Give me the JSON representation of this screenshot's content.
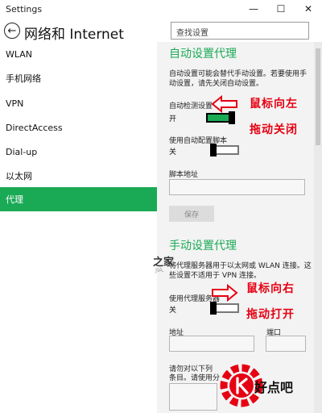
{
  "window": {
    "title": "Settings",
    "minimize": "—",
    "maximize": "☐",
    "close": "✕"
  },
  "header": {
    "back": "←",
    "title": "网络和 Internet",
    "search_placeholder": "查找设置"
  },
  "sidebar": {
    "items": [
      {
        "label": "WLAN"
      },
      {
        "label": "手机网络"
      },
      {
        "label": "VPN"
      },
      {
        "label": "DirectAccess"
      },
      {
        "label": "Dial-up"
      },
      {
        "label": "以太网"
      },
      {
        "label": "代理"
      }
    ],
    "active_index": 6
  },
  "auto_proxy": {
    "heading": "自动设置代理",
    "description": "自动设置可能会替代手动设置。若要使用手动设置，请先关闭自动设置。",
    "detect_label": "自动检测设置",
    "detect_state": "开",
    "detect_on": true,
    "script_label": "使用自动配置脚本",
    "script_state": "关",
    "script_on": false,
    "address_label": "脚本地址",
    "address_value": "",
    "save_label": "保存"
  },
  "manual_proxy": {
    "heading": "手动设置代理",
    "description": "将代理服务器用于以太网或 WLAN 连接。这些设置不适用于 VPN 连接。",
    "use_label": "使用代理服务器",
    "use_state": "关",
    "use_on": false,
    "address_label": "地址",
    "port_label": "端口",
    "address_value": "",
    "port_value": "",
    "exceptions_label": "请勿对以下列",
    "exceptions_label2": "条目。请使用分",
    "exceptions_value": ""
  },
  "annotations": {
    "top_line1": "鼠标向左",
    "top_line2": "拖动关闭",
    "bottom_line1": "鼠标向右",
    "bottom_line2": "拖动打开"
  },
  "watermarks": {
    "site": "之家",
    "site_small": "JIA.",
    "logo_text": "好点吧"
  },
  "colors": {
    "accent": "#1aaa55",
    "annotation": "#e60012"
  }
}
